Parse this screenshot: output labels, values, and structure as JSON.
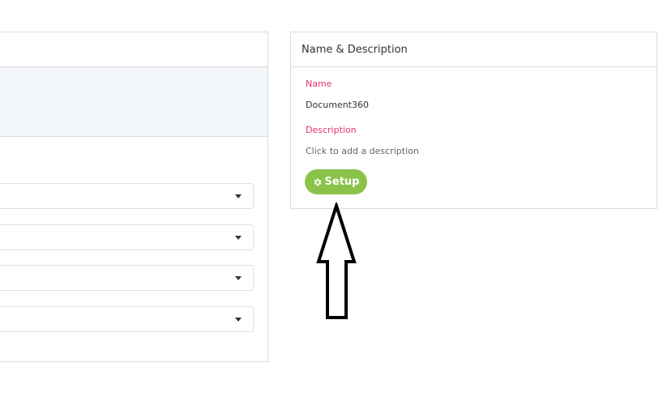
{
  "name_description_panel": {
    "title": "Name & Description",
    "name_label": "Name",
    "name_value": "Document360",
    "description_label": "Description",
    "description_placeholder": "Click to add a description",
    "setup_button_label": "Setup",
    "setup_icon": "gear-icon",
    "accent_color": "#e8336a",
    "button_color": "#8bc34a"
  },
  "left_panel": {
    "dropdown_count": 4,
    "caret_icon": "caret-down-icon"
  },
  "annotation": {
    "arrow_icon": "up-arrow-icon"
  }
}
